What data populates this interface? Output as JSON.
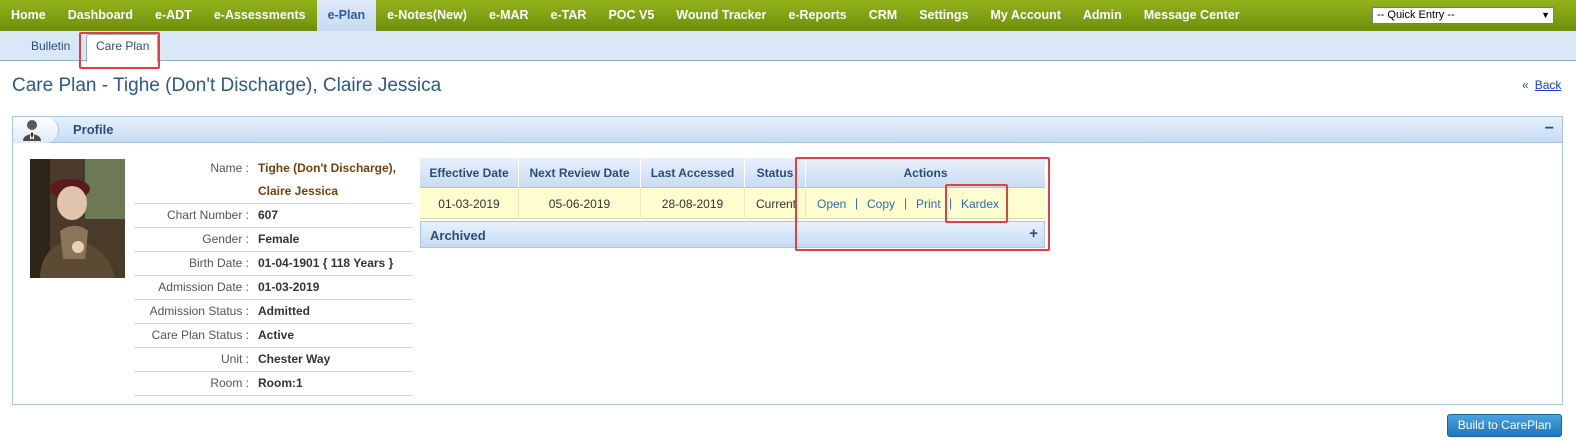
{
  "topnav": {
    "items": [
      "Home",
      "Dashboard",
      "e-ADT",
      "e-Assessments",
      "e-Plan",
      "e-Notes(New)",
      "e-MAR",
      "e-TAR",
      "POC V5",
      "Wound Tracker",
      "e-Reports",
      "CRM",
      "Settings",
      "My Account",
      "Admin",
      "Message Center"
    ],
    "active": "e-Plan",
    "quick_entry": "-- Quick Entry --"
  },
  "subnav": {
    "items": [
      "Bulletin",
      "Care Plan"
    ],
    "active": "Care Plan"
  },
  "page": {
    "title": "Care Plan - Tighe (Don't Discharge), Claire Jessica",
    "back_prefix": "«",
    "back_label": "Back"
  },
  "profile": {
    "title": "Profile",
    "collapse": "−",
    "fields": [
      {
        "label": "Name :",
        "value": "Tighe (Don't Discharge),",
        "value2": "Claire Jessica"
      },
      {
        "label": "Chart Number :",
        "value": "607"
      },
      {
        "label": "Gender :",
        "value": "Female"
      },
      {
        "label": "Birth Date :",
        "value": "01-04-1901 { 118 Years }"
      },
      {
        "label": "Admission Date :",
        "value": "01-03-2019"
      },
      {
        "label": "Admission Status :",
        "value": "Admitted"
      },
      {
        "label": "Care Plan Status :",
        "value": "Active"
      },
      {
        "label": "Unit :",
        "value": "Chester Way"
      },
      {
        "label": "Room :",
        "value": "Room:1"
      }
    ]
  },
  "careplan": {
    "headers": [
      "Effective Date",
      "Next Review Date",
      "Last Accessed",
      "Status",
      "Actions"
    ],
    "row": {
      "effective_date": "01-03-2019",
      "next_review_date": "05-06-2019",
      "last_accessed": "28-08-2019",
      "status": "Current"
    },
    "actions": [
      "Open",
      "Copy",
      "Print",
      "Kardex"
    ],
    "archived_label": "Archived",
    "archived_toggle": "+"
  },
  "build_button": "Build to CarePlan",
  "colors": {
    "nav_green": "#7fa116",
    "accent_blue": "#2b5a8a",
    "highlight_red": "#e04040",
    "row_yellow": "#fefdd0"
  }
}
